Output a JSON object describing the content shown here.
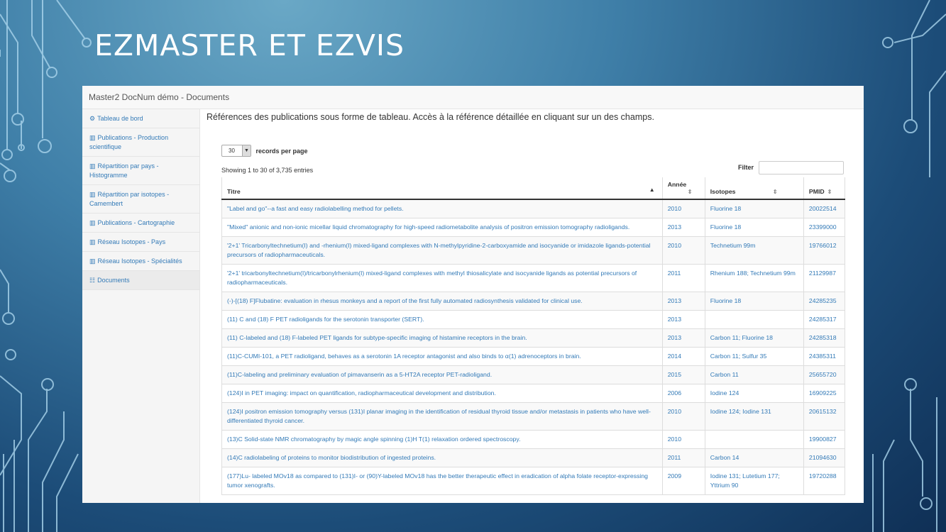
{
  "slide": {
    "title": "EZMASTER ET EZVIS"
  },
  "app": {
    "title": "Master2 DocNum démo - Documents",
    "sidebar": [
      {
        "label": "Tableau de bord",
        "icon": "dashboard-icon"
      },
      {
        "label": "Publications - Production scientifique",
        "icon": "bar-chart-icon"
      },
      {
        "label": "Répartition par pays - Histogramme",
        "icon": "bar-chart-icon"
      },
      {
        "label": "Répartition par isotopes - Camembert",
        "icon": "bar-chart-icon"
      },
      {
        "label": "Publications - Cartographie",
        "icon": "bar-chart-icon"
      },
      {
        "label": "Réseau Isotopes - Pays",
        "icon": "bar-chart-icon"
      },
      {
        "label": "Réseau Isotopes - Spécialités",
        "icon": "bar-chart-icon"
      },
      {
        "label": "Documents",
        "icon": "table-icon"
      }
    ],
    "main": {
      "intro": "Références des publications sous forme de tableau. Accès à la référence détaillée en cliquant sur un des champs.",
      "page_size": "30",
      "records_label": "records per page",
      "showing": "Showing 1 to 30 of 3,735 entries",
      "filter_label": "Filter",
      "columns": [
        "Titre",
        "Année",
        "Isotopes",
        "PMID"
      ],
      "rows": [
        [
          "\"Label and go\"--a fast and easy radiolabelling method for pellets.",
          "2010",
          "Fluorine 18",
          "20022514"
        ],
        [
          "\"Mixed\" anionic and non-ionic micellar liquid chromatography for high-speed radiometabolite analysis of positron emission tomography radioligands.",
          "2013",
          "Fluorine 18",
          "23399000"
        ],
        [
          "'2+1' Tricarbonyltechnetium(I) and -rhenium(I) mixed-ligand complexes with N-methylpyridine-2-carboxyamide and isocyanide or imidazole ligands-potential precursors of radiopharmaceuticals.",
          "2010",
          "Technetium 99m",
          "19766012"
        ],
        [
          "'2+1' tricarbonyltechnetium(I)/tricarbonylrhenium(I) mixed-ligand complexes with methyl thiosalicylate and isocyanide ligands as potential precursors of radiopharmaceuticals.",
          "2011",
          "Rhenium 188; Technetium 99m",
          "21129987"
        ],
        [
          "(-)-[(18) F]Flubatine: evaluation in rhesus monkeys and a report of the first fully automated radiosynthesis validated for clinical use.",
          "2013",
          "Fluorine 18",
          "24285235"
        ],
        [
          "(11) C and (18) F PET radioligands for the serotonin transporter (SERT).",
          "2013",
          "",
          "24285317"
        ],
        [
          "(11) C-labeled and (18) F-labeled PET ligands for subtype-specific imaging of histamine receptors in the brain.",
          "2013",
          "Carbon 11; Fluorine 18",
          "24285318"
        ],
        [
          "(11)C-CUMI-101, a PET radioligand, behaves as a serotonin 1A receptor antagonist and also binds to α(1) adrenoceptors in brain.",
          "2014",
          "Carbon 11; Sulfur 35",
          "24385311"
        ],
        [
          "(11)C-labeling and preliminary evaluation of pimavanserin as a 5-HT2A receptor PET-radioligand.",
          "2015",
          "Carbon 11",
          "25655720"
        ],
        [
          "(124)I in PET imaging: impact on quantification, radiopharmaceutical development and distribution.",
          "2006",
          "Iodine 124",
          "16909225"
        ],
        [
          "(124)I positron emission tomography versus (131)I planar imaging in the identification of residual thyroid tissue and/or metastasis in patients who have well-differentiated thyroid cancer.",
          "2010",
          "Iodine 124; Iodine 131",
          "20615132"
        ],
        [
          "(13)C Solid-state NMR chromatography by magic angle spinning (1)H T(1) relaxation ordered spectroscopy.",
          "2010",
          "",
          "19900827"
        ],
        [
          "(14)C radiolabeling of proteins to monitor biodistribution of ingested proteins.",
          "2011",
          "Carbon 14",
          "21094630"
        ],
        [
          "(177)Lu- labeled MOv18 as compared to (131)I- or (90)Y-labeled MOv18 has the better therapeutic effect in eradication of alpha folate receptor-expressing tumor xenografts.",
          "2009",
          "Iodine 131; Lutetium 177; Yttrium 90",
          "19720288"
        ]
      ]
    }
  }
}
